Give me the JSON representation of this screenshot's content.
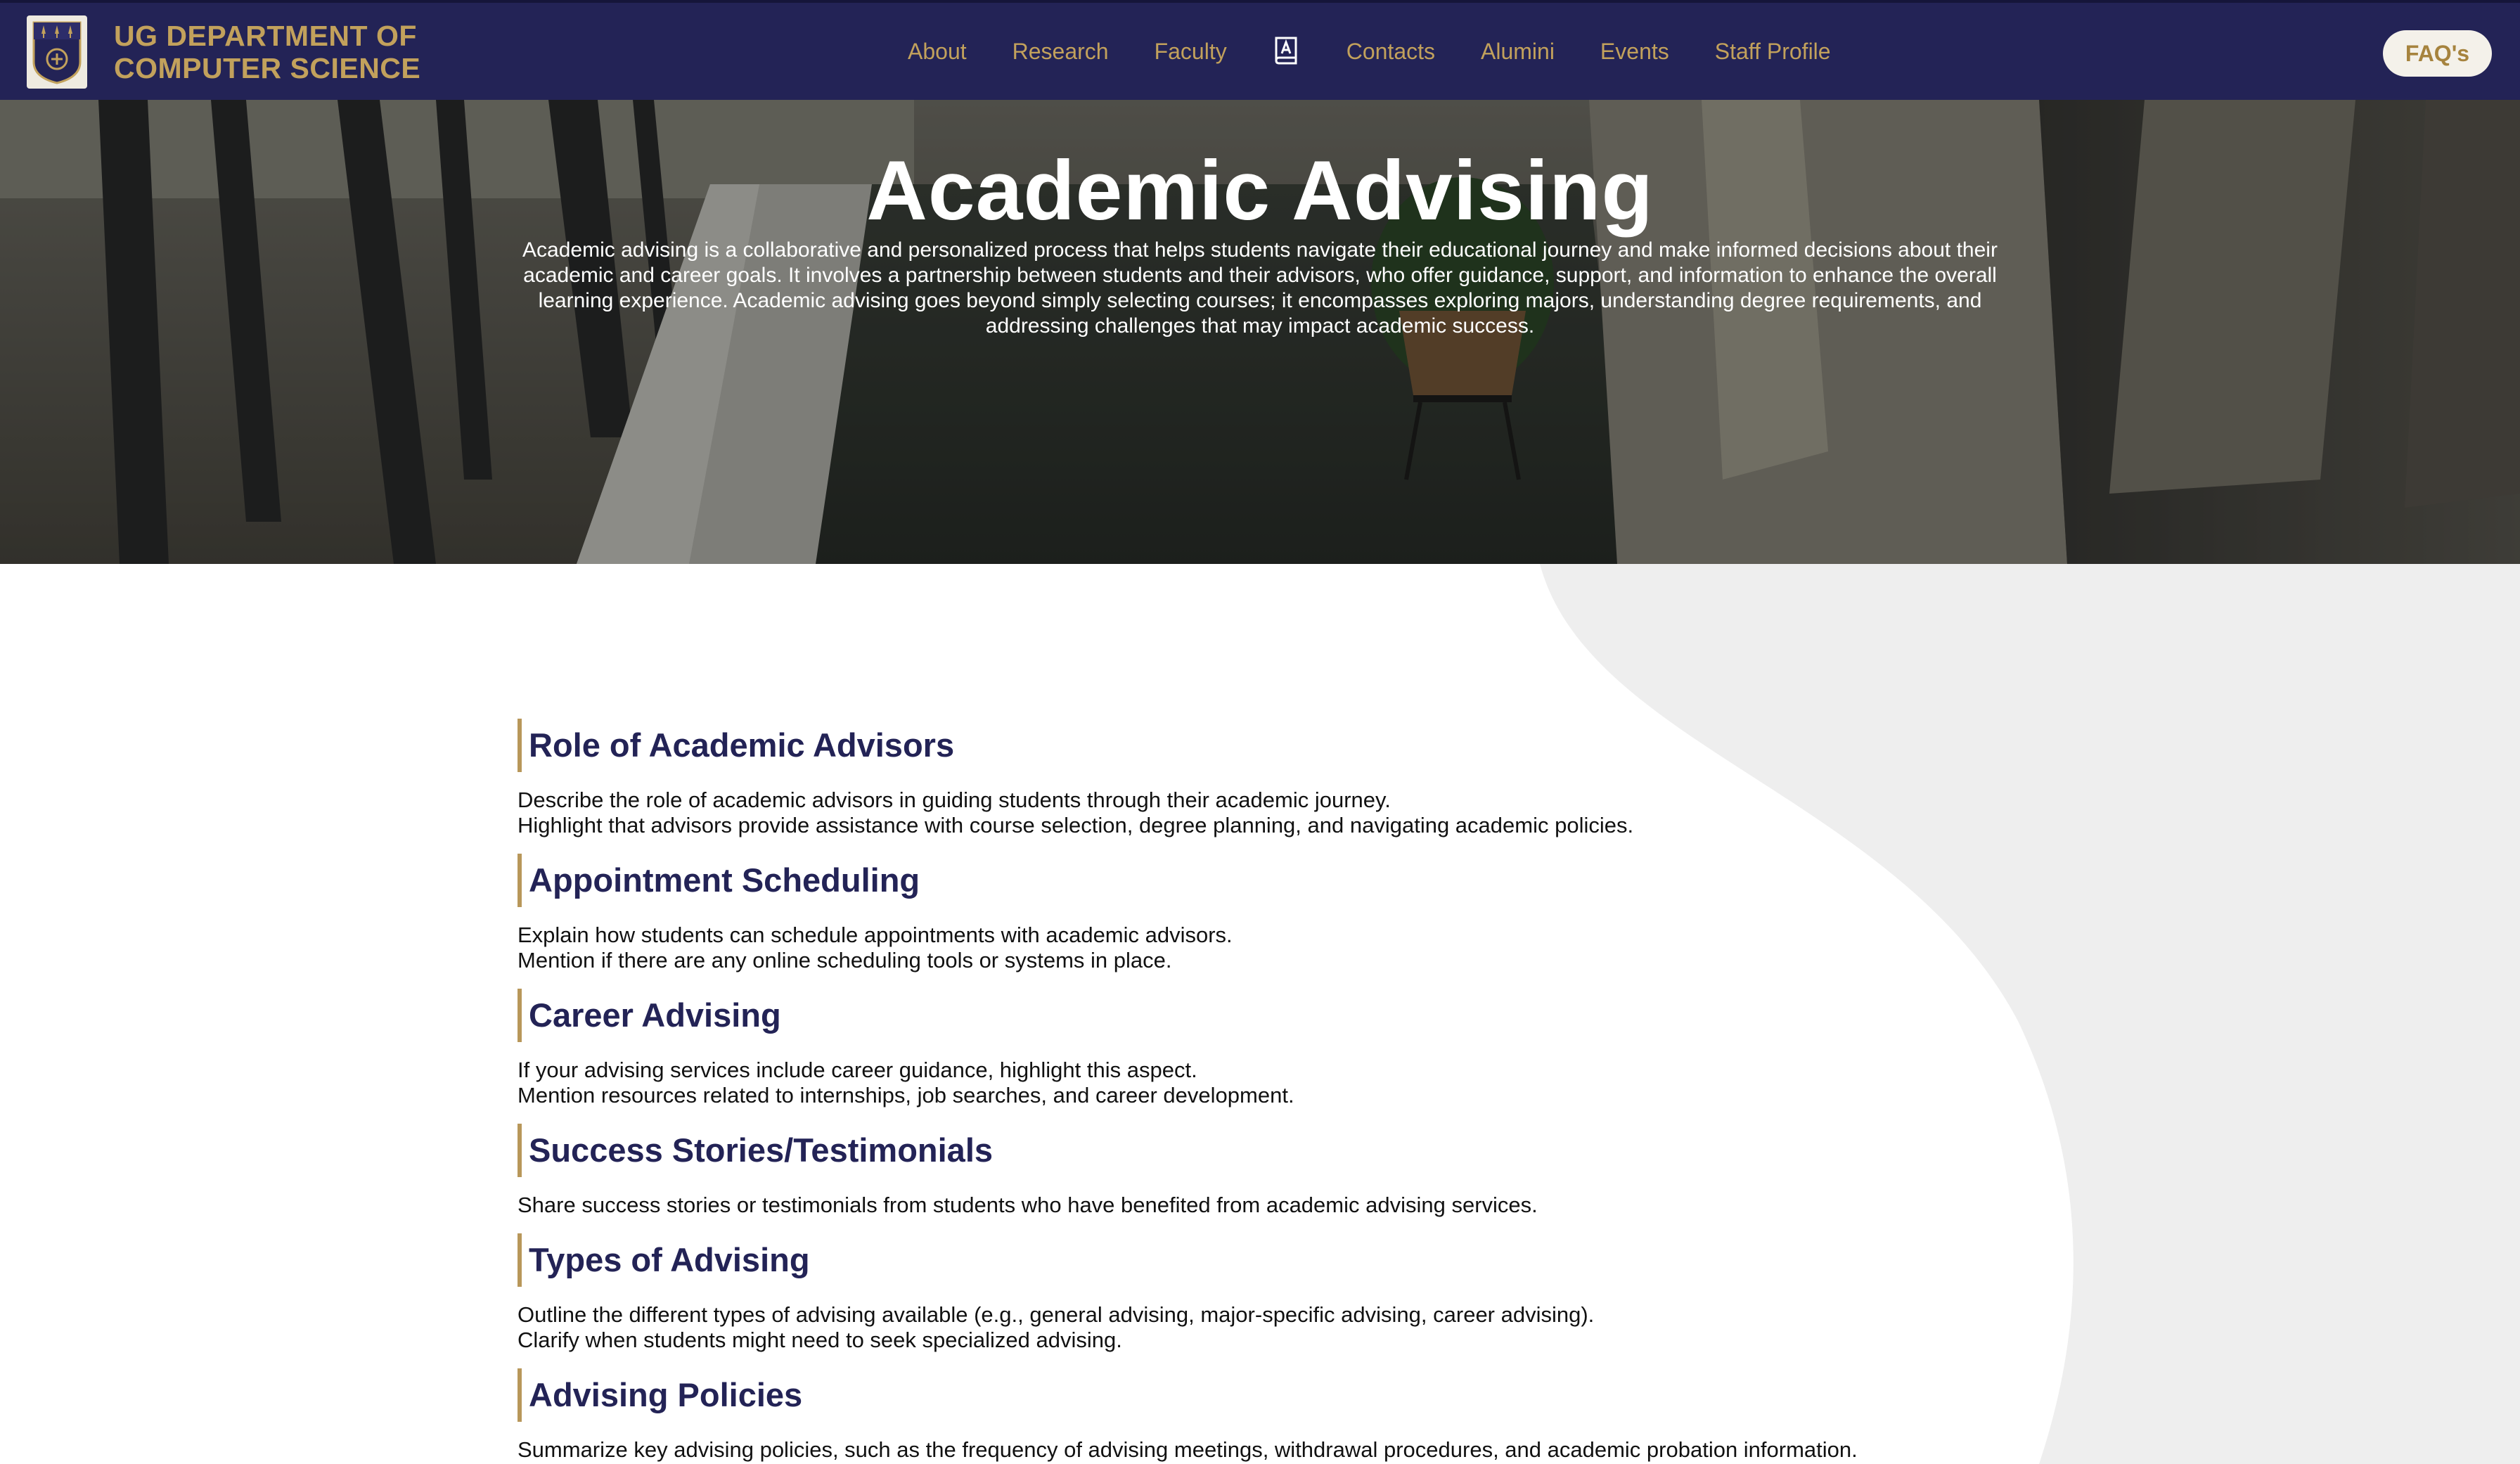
{
  "header": {
    "brand_line1": "UG DEPARTMENT OF",
    "brand_line2": "COMPUTER SCIENCE",
    "logo_icon": "university-crest-icon",
    "nav": [
      {
        "label": "About"
      },
      {
        "label": "Research"
      },
      {
        "label": "Faculty"
      },
      {
        "icon": "book-a-icon"
      },
      {
        "label": "Contacts"
      },
      {
        "label": "Alumini"
      },
      {
        "label": "Events"
      },
      {
        "label": "Staff Profile"
      }
    ],
    "faq_label": "FAQ's"
  },
  "hero": {
    "title": "Academic Advising",
    "description": "Academic advising is a collaborative and personalized process that helps students navigate their educational journey and make informed decisions about their academic and career goals. It involves a partnership between students and their advisors, who offer guidance, support, and information to enhance the overall learning experience. Academic advising goes beyond simply selecting courses; it encompasses exploring majors, understanding degree requirements, and addressing challenges that may impact academic success."
  },
  "sections": [
    {
      "heading": "Role of Academic Advisors",
      "lines": [
        "Describe the role of academic advisors in guiding students through their academic journey.",
        "Highlight that advisors provide assistance with course selection, degree planning, and navigating academic policies."
      ]
    },
    {
      "heading": "Appointment Scheduling",
      "lines": [
        "Explain how students can schedule appointments with academic advisors.",
        "Mention if there are any online scheduling tools or systems in place."
      ]
    },
    {
      "heading": "Career Advising",
      "lines": [
        "If your advising services include career guidance, highlight this aspect.",
        "Mention resources related to internships, job searches, and career development."
      ]
    },
    {
      "heading": "Success Stories/Testimonials",
      "lines": [
        "Share success stories or testimonials from students who have benefited from academic advising services."
      ]
    },
    {
      "heading": "Types of Advising",
      "lines": [
        "Outline the different types of advising available (e.g., general advising, major-specific advising, career advising).",
        "Clarify when students might need to seek specialized advising."
      ]
    },
    {
      "heading": "Advising Policies",
      "lines": [
        "Summarize key advising policies, such as the frequency of advising meetings, withdrawal procedures, and academic probation information."
      ]
    }
  ],
  "colors": {
    "nav_background": "#232356",
    "accent_gold": "#c2a15c",
    "heading_navy": "#232356",
    "blob_gray": "#eeeeee"
  }
}
